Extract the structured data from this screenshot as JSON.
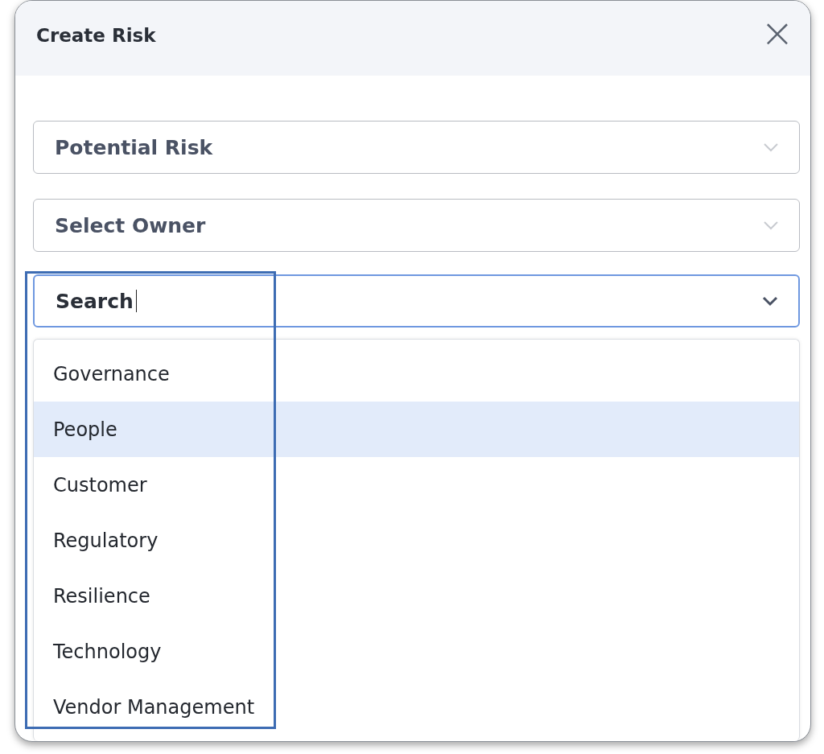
{
  "dialog": {
    "title": "Create Risk",
    "close": "×"
  },
  "fields": [
    {
      "placeholder": "Potential Risk",
      "focused": false
    },
    {
      "placeholder": "Select Owner",
      "focused": false
    }
  ],
  "search": {
    "value": "Search",
    "focused": true
  },
  "options": [
    {
      "label": "Governance",
      "selected": false
    },
    {
      "label": "People",
      "selected": true
    },
    {
      "label": "Customer",
      "selected": false
    },
    {
      "label": "Regulatory",
      "selected": false
    },
    {
      "label": "Resilience",
      "selected": false
    },
    {
      "label": "Technology",
      "selected": false
    },
    {
      "label": "Vendor Management",
      "selected": false
    }
  ]
}
